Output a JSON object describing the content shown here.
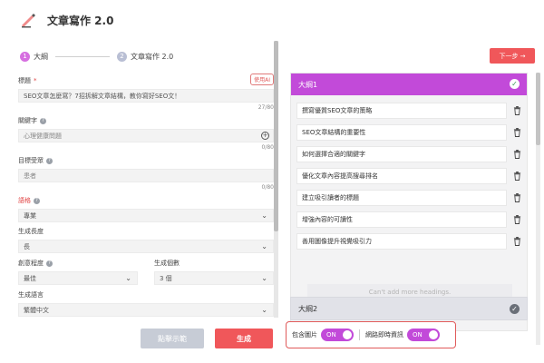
{
  "header": {
    "title": "文章寫作 2.0",
    "logo_icon": "pen-icon"
  },
  "steps": [
    {
      "num": "1",
      "label": "大綱",
      "active": true
    },
    {
      "num": "2",
      "label": "文章寫作 2.0",
      "active": false
    }
  ],
  "form": {
    "title_label": "標題",
    "title_req": "*",
    "ai_button": "使用AI",
    "title_value": "SEO文章怎麼寫？7招拆解文章結構，教你寫好SEO文！",
    "title_count": "27/80",
    "keywords_label": "關鍵字",
    "keywords_placeholder": "心理健康問題",
    "keywords_count": "0/80",
    "audience_label": "目標受眾",
    "audience_placeholder": "患者",
    "audience_count": "0/80",
    "tone_label": "語格",
    "tone_value": "專業",
    "length_label": "生成長度",
    "length_value": "長",
    "detail_label": "創意程度",
    "detail_value": "最佳",
    "count_label": "生成個數",
    "count_value": "3 個",
    "lang_label": "生成語言",
    "lang_value": "繁體中文",
    "example_button": "點擊示範",
    "generate_button": "生成"
  },
  "outline": {
    "next_button": "下一步 →",
    "heading1": "大綱1",
    "items": [
      "撰寫優質SEO文章的策略",
      "SEO文章結構的重要性",
      "如何選擇合適的關鍵字",
      "優化文章內容提高搜尋排名",
      "建立吸引讀者的標題",
      "增強內容的可讀性",
      "善用圖像提升視覺吸引力"
    ],
    "cant_add": "Can't add more headings.",
    "heading2": "大綱2"
  },
  "options": {
    "include_images_label": "包含圖片",
    "include_images_state": "ON",
    "web_search_label": "網路即時資訊",
    "web_search_state": "ON"
  },
  "colors": {
    "accent": "#c24ad9",
    "primary_button": "#f0575a"
  }
}
